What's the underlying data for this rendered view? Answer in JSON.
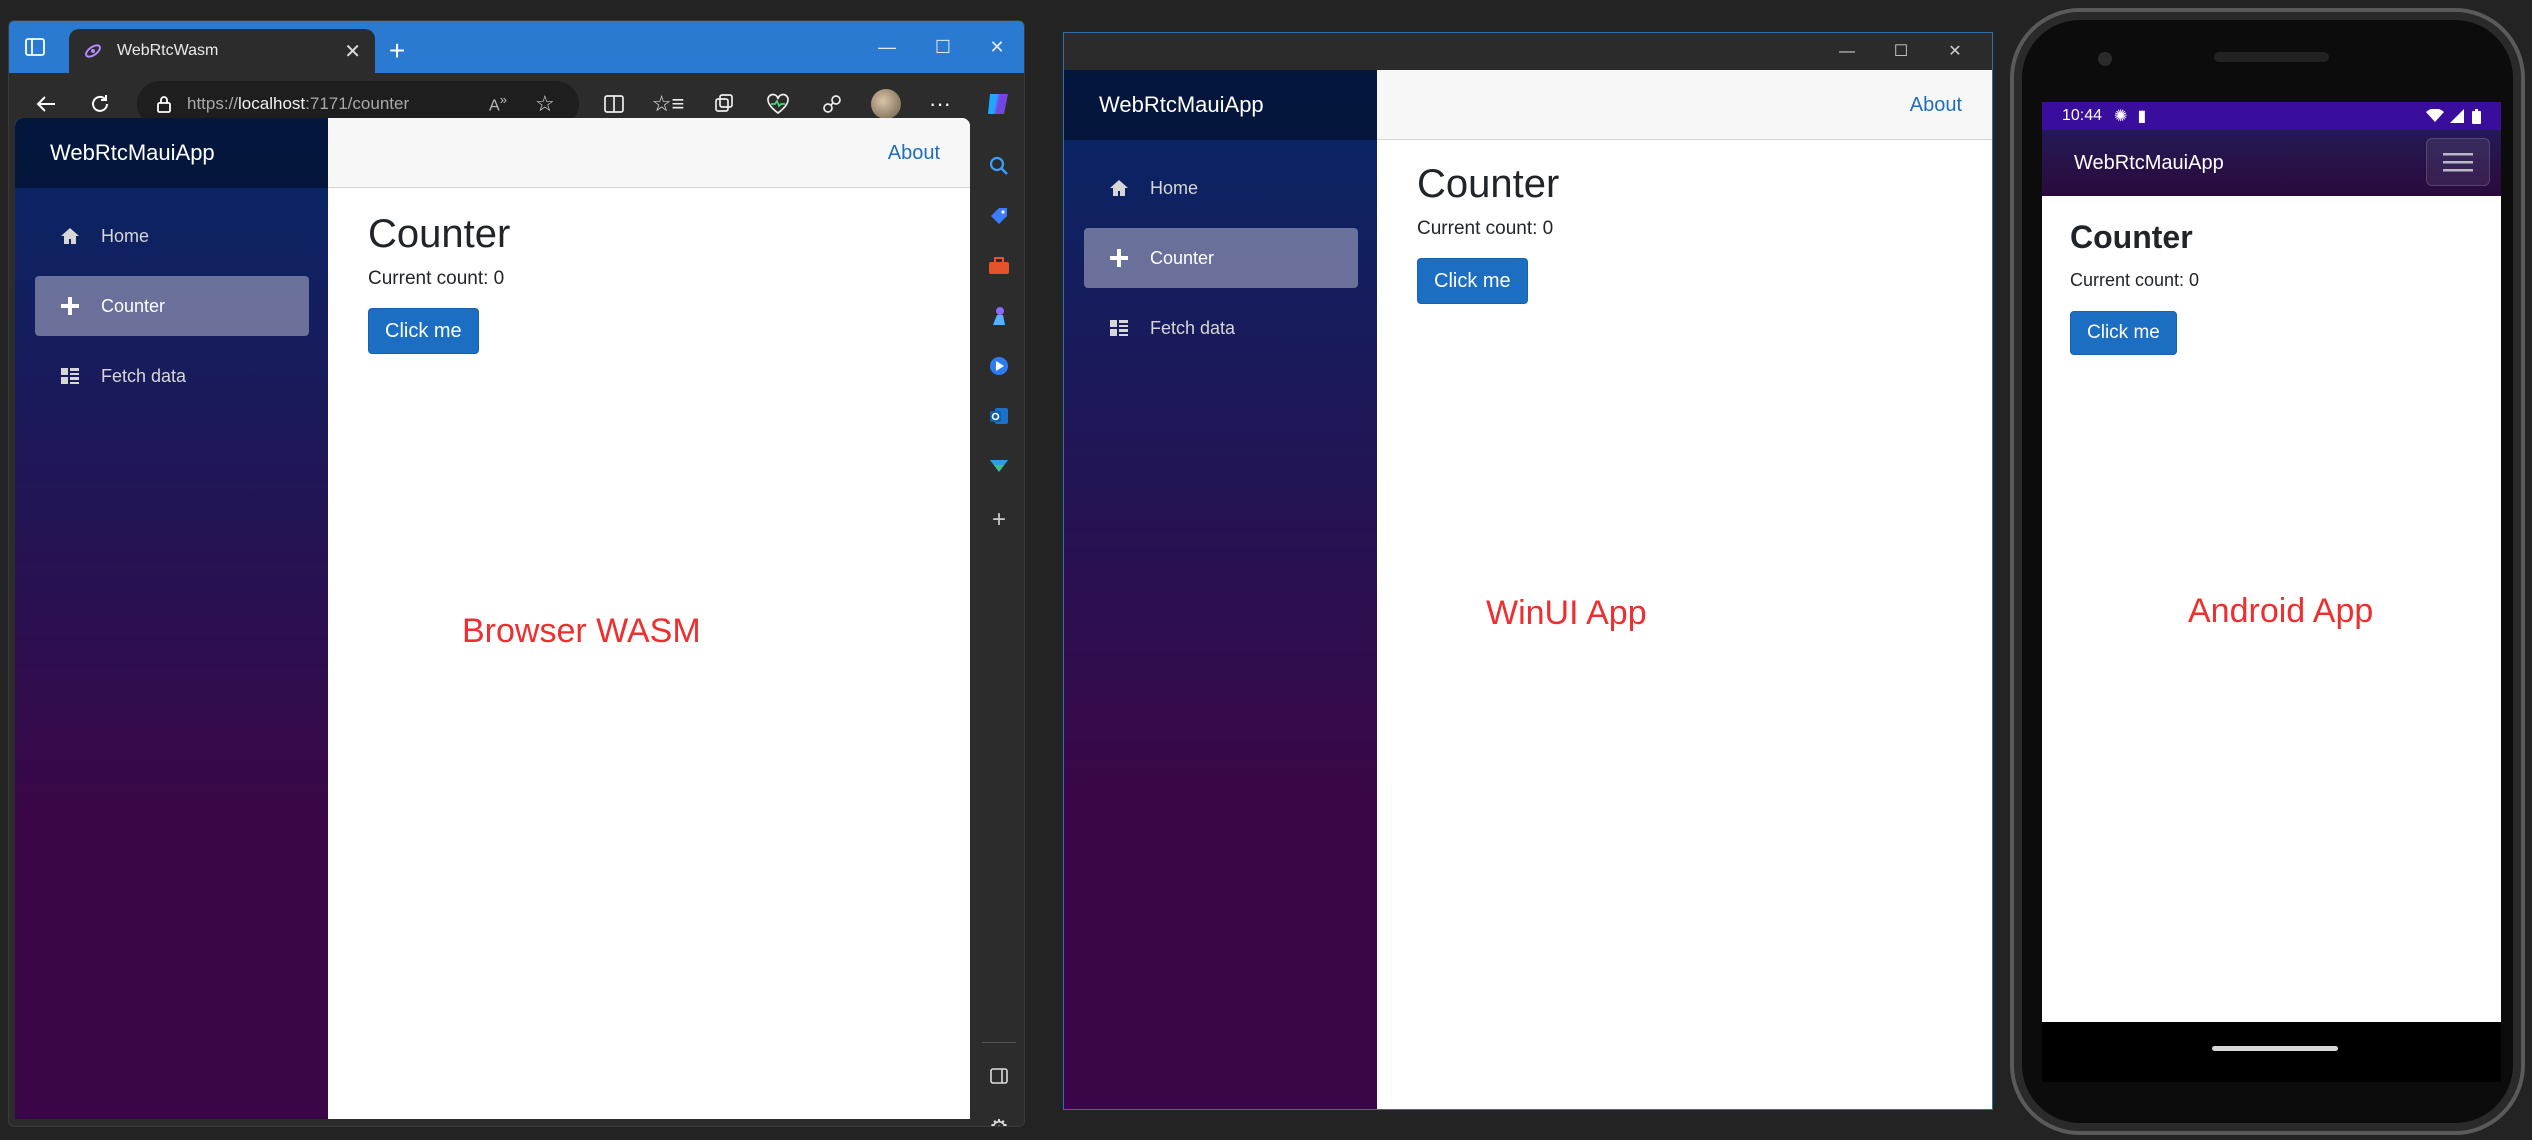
{
  "browser": {
    "tab_title": "WebRtcWasm",
    "url_scheme": "https://",
    "url_host": "localhost",
    "url_rest": ":7171/counter",
    "new_tab": "+",
    "more": "···"
  },
  "app": {
    "brand": "WebRtcMauiApp",
    "about": "About",
    "nav": [
      {
        "label": "Home",
        "icon": "home-icon"
      },
      {
        "label": "Counter",
        "icon": "plus-icon",
        "active": true
      },
      {
        "label": "Fetch data",
        "icon": "list-icon"
      }
    ],
    "page_title": "Counter",
    "count_text": "Current count: 0",
    "button_label": "Click me"
  },
  "phone": {
    "time": "10:44"
  },
  "labels": {
    "browser": "Browser WASM",
    "winui": "WinUI App",
    "android": "Android App"
  },
  "colors": {
    "accent": "#1b6ec2",
    "browser_titlebar": "#2b7ad1",
    "label_red": "#ee2f2f",
    "nav_gradient_top": "#052767",
    "nav_gradient_bottom": "#3a0647"
  }
}
